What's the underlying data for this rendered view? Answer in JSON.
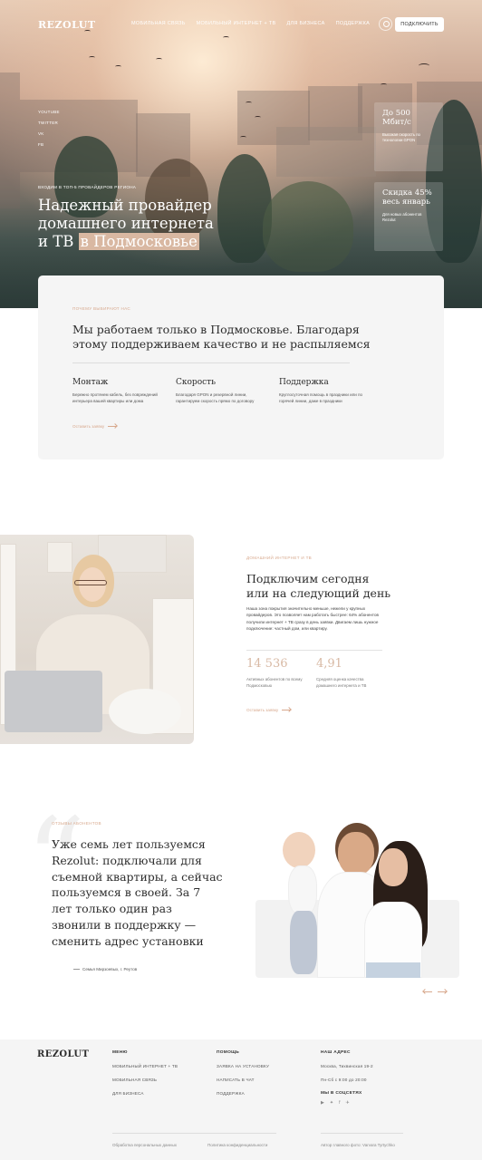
{
  "header": {
    "logo": "REZOLUT",
    "nav": [
      "МОБИЛЬНАЯ СВЯЗЬ",
      "МОБИЛЬНЫЙ ИНТЕРНЕТ + ТВ",
      "ДЛЯ БИЗНЕСА",
      "ПОДДЕРЖКА"
    ],
    "connect_button": "ПОДКЛЮЧИТЬ"
  },
  "hero": {
    "socials": [
      "YOUTUBE",
      "TWITTER",
      "VK",
      "FB"
    ],
    "eyebrow": "ВХОДИМ В ТОП-5 ПРОВАЙДЕРОВ РЕГИОНА",
    "title_main": "Надежный провайдер домашнего интернета и ТВ ",
    "title_highlight": "в Подмосковье",
    "card1": {
      "big": "До 500 Мбит/с",
      "small": "Высокая скорость по технологии GPON"
    },
    "card2": {
      "big": "Скидка 45% весь январь",
      "small": "Для новых абонентов Rezolut"
    }
  },
  "why": {
    "eyebrow": "ПОЧЕМУ ВЫБИРАЮТ НАС",
    "title": "Мы работаем только в Подмосковье. Благодаря этому поддерживаем качество и не распыляемся",
    "features": [
      {
        "title": "Монтаж",
        "desc": "Бережно протянем кабель, без повреждений интерьера вашей квартиры или дома"
      },
      {
        "title": "Скорость",
        "desc": "Благодаря GPON и резервной линии, гарантируем скорость прямо по договору"
      },
      {
        "title": "Поддержка",
        "desc": "Круглосуточная помощь в праздники или по горячей линии, даже в праздники"
      }
    ],
    "link": "Оставить заявку"
  },
  "connect": {
    "eyebrow": "ДОМАШНИЙ ИНТЕРНЕТ И ТВ",
    "title": "Подключим сегодня или на следующий день",
    "desc": "Наша зона покрытия значительно меньше, нежели у крупных провайдеров. Это позволяет нам работать быстрее: 64% абонентов получили интернет + ТВ сразу в день заявки. Двигаем лишь нужное подключение: частный дом, или квартиру.",
    "stats": [
      {
        "value": "14 536",
        "label": "Активных абонентов по всему Подмосковью"
      },
      {
        "value": "4,91",
        "label": "Средняя оценка качества домашнего интернета и ТВ"
      }
    ],
    "link": "Оставить заявку"
  },
  "review": {
    "eyebrow": "ОТЗЫВЫ АБОНЕНТОВ",
    "text": "Уже семь лет пользуемся Rezolut: подключали для съемной квартиры, а сейчас пользуемся в своей. За 7 лет только один раз звонили в поддержку — сменить адрес установки",
    "author": "Семья Мирзоевых, г. Реутов"
  },
  "footer": {
    "logo": "REZOLUT",
    "menu_title": "МЕНЮ",
    "menu": [
      "МОБИЛЬНЫЙ ИНТЕРНЕТ + ТВ",
      "МОБИЛЬНАЯ СВЯЗЬ",
      "ДЛЯ БИЗНЕСА"
    ],
    "help_title": "ПОМОЩЬ",
    "help": [
      "ЗАЯВКА НА УСТАНОВКУ",
      "НАПИСАТЬ В ЧАТ",
      "ПОДДЕРЖКА"
    ],
    "address_title": "НАШ АДРЕС",
    "address": "Москва, Тихвинская 19-2",
    "hours": "Пн-Сб с 9:00 до 20:00",
    "social_title": "МЫ В СОЦСЕТЯХ",
    "bottom_left": "Обработка персональных данных",
    "bottom_mid": "Политика конфиденциальности",
    "bottom_right": "Автор главного фото: Varvara Tyrtychko"
  }
}
